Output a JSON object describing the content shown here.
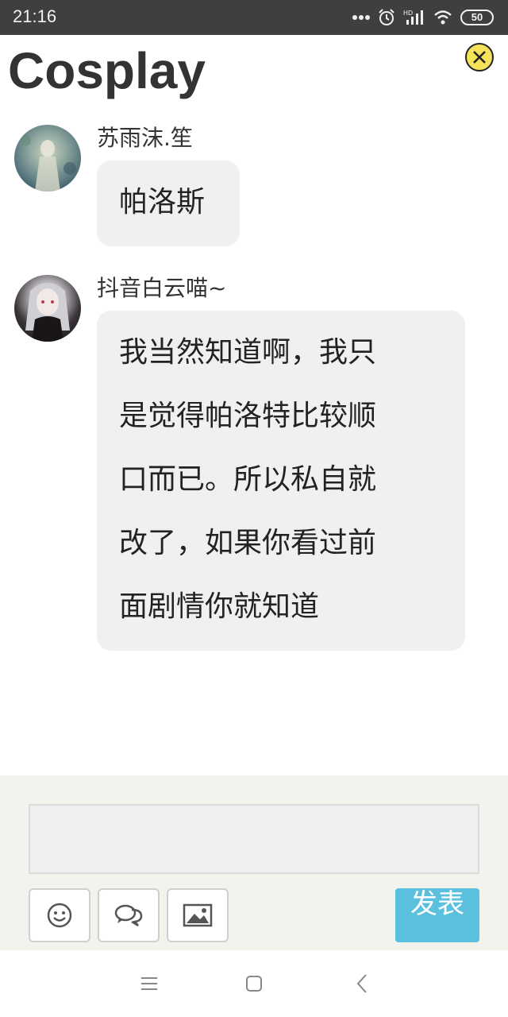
{
  "status_bar": {
    "time": "21:16",
    "battery": "50",
    "icons": [
      "more-dots-icon",
      "alarm-icon",
      "hd-signal-icon",
      "wifi-icon",
      "battery-icon"
    ]
  },
  "header": {
    "title": "Cosplay",
    "close_icon": "close-icon",
    "close_color": "#f6e25a"
  },
  "messages": [
    {
      "sender": "苏雨沫.笙",
      "lines": [
        "帕洛斯"
      ]
    },
    {
      "sender": "抖音白云喵~",
      "lines": [
        "我当然知道啊，我只",
        "是觉得帕洛特比较顺",
        "口而已。所以私自就",
        "改了，如果你看过前",
        "面剧情你就知道"
      ]
    }
  ],
  "composer": {
    "input_value": "",
    "tools": [
      "emoji-icon",
      "chat-bubbles-icon",
      "image-icon"
    ],
    "send_label": "发表",
    "send_color": "#5bc0de"
  },
  "nav_bar": {
    "icons": [
      "menu-icon",
      "home-icon",
      "back-icon"
    ]
  }
}
